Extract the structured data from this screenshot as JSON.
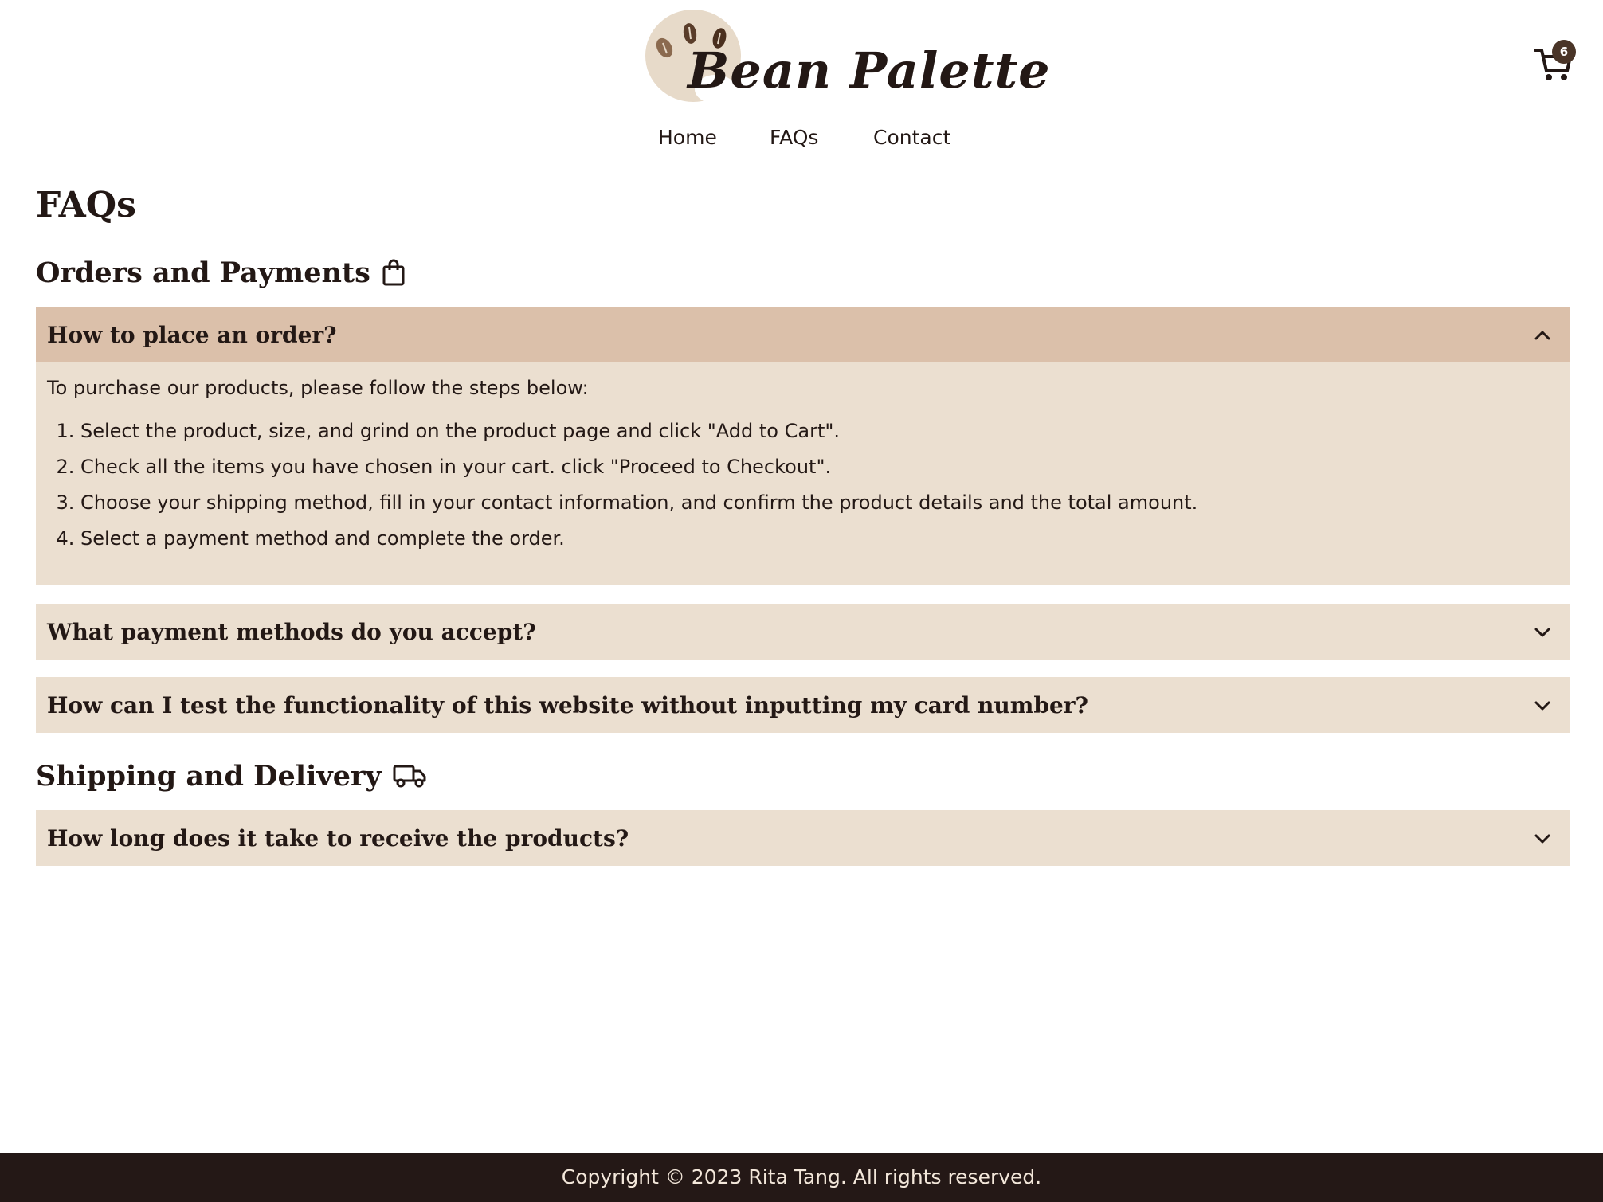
{
  "header": {
    "logo_text": "Bean Palette",
    "cart_count": "6"
  },
  "nav": {
    "items": [
      {
        "label": "Home"
      },
      {
        "label": "FAQs"
      },
      {
        "label": "Contact"
      }
    ]
  },
  "main": {
    "title": "FAQs",
    "sections": [
      {
        "title": "Orders and Payments",
        "icon": "shopping-bag-icon",
        "faqs": [
          {
            "question": "How to place an order?",
            "expanded": true,
            "intro": "To purchase our products, please follow the steps below:",
            "steps": [
              "Select the product, size, and grind on the product page and click \"Add to Cart\".",
              "Check all the items you have chosen in your cart. click \"Proceed to Checkout\".",
              "Choose your shipping method, fill in your contact information, and confirm the product details and the total amount.",
              "Select a payment method and complete the order."
            ]
          },
          {
            "question": "What payment methods do you accept?",
            "expanded": false
          },
          {
            "question": "How can I test the functionality of this website without inputting my card number?",
            "expanded": false
          }
        ]
      },
      {
        "title": "Shipping and Delivery",
        "icon": "truck-icon",
        "faqs": [
          {
            "question": "How long does it take to receive the products?",
            "expanded": false
          }
        ]
      }
    ]
  },
  "footer": {
    "copyright": "Copyright © 2023 Rita Tang. All rights reserved."
  },
  "colors": {
    "accordion_bg": "#ebdfd0",
    "accordion_open_header": "#dbc0aa",
    "footer_bg": "#241816",
    "text_dark": "#231815",
    "badge": "#4a3528"
  }
}
